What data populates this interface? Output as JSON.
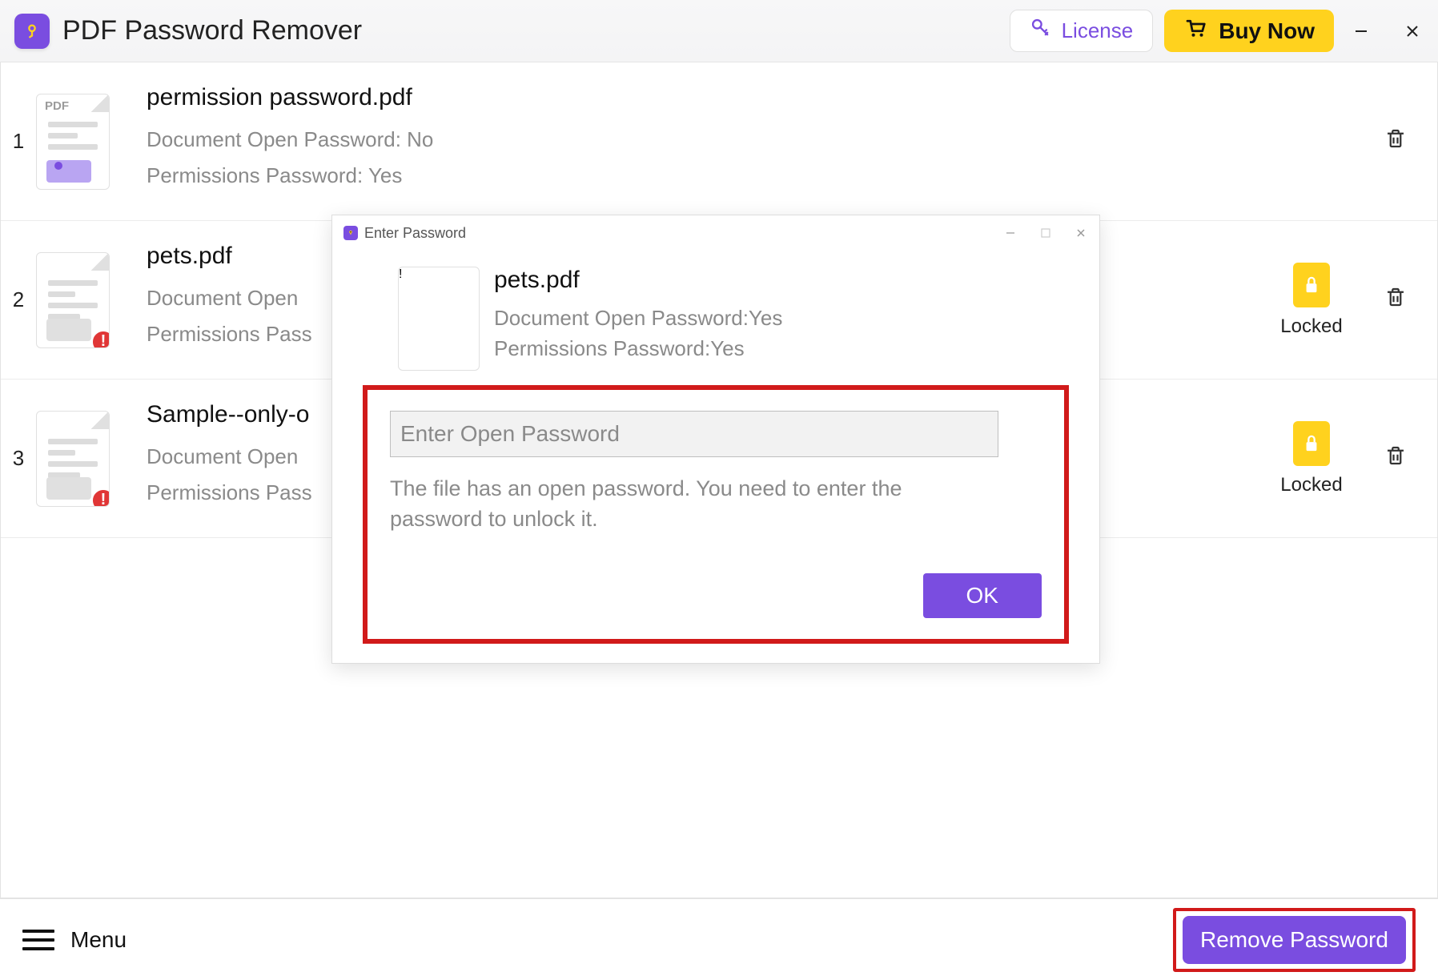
{
  "app": {
    "title": "PDF Password Remover"
  },
  "toolbar": {
    "license_label": "License",
    "buy_label": "Buy Now"
  },
  "files": [
    {
      "index": "1",
      "name": "permission password.pdf",
      "open_pw_line": "Document Open Password: No",
      "perm_pw_line": "Permissions Password: Yes",
      "locked": false
    },
    {
      "index": "2",
      "name": "pets.pdf",
      "open_pw_line": "Document Open",
      "perm_pw_line": "Permissions Pass",
      "locked": true,
      "status_label": "Locked"
    },
    {
      "index": "3",
      "name": "Sample--only-o",
      "open_pw_line": "Document Open",
      "perm_pw_line": "Permissions Pass",
      "locked": true,
      "status_label": "Locked"
    }
  ],
  "footer": {
    "menu_label": "Menu",
    "remove_label": "Remove Password"
  },
  "dialog": {
    "title": "Enter Password",
    "file_name": "pets.pdf",
    "open_pw_line": "Document Open Password:Yes",
    "perm_pw_line": "Permissions Password:Yes",
    "input_placeholder": "Enter Open Password",
    "help_text": "The file has an open password. You need to enter the password to unlock it.",
    "ok_label": "OK"
  }
}
